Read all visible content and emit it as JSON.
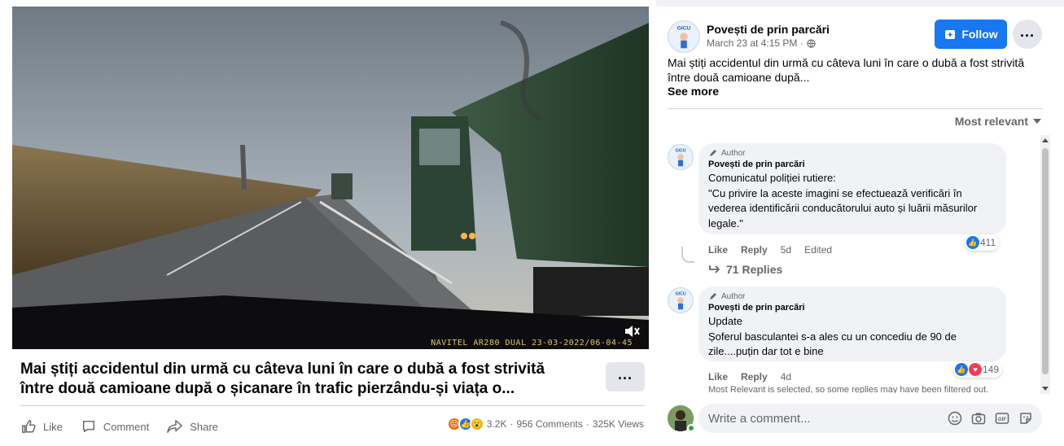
{
  "video": {
    "osd_text": "NAVITEL AR280 DUAL 23-03-2022/06-04-45"
  },
  "post_title": "Mai știți accidentul din urmă cu câteva luni în care o dubă a fost strivită între două camioane după o șicanare în trafic pierzându-și viața o...",
  "actions": {
    "like": "Like",
    "comment": "Comment",
    "share": "Share"
  },
  "stats": {
    "reactions": "3.2K",
    "comments": "956 Comments",
    "views": "325K Views",
    "separator": "·"
  },
  "post": {
    "page_name": "Povești de prin parcări",
    "time": "March 23 at 4:15 PM ·",
    "follow_label": "Follow",
    "text_line1": "Mai știți accidentul din urmă cu câteva luni în care o dubă a fost strivită",
    "text_line2": "între două camioane după...",
    "see_more": "See more"
  },
  "sort_label": "Most relevant",
  "comments": [
    {
      "tag": "Author",
      "name": "Povești de prin parcări",
      "lines": [
        "Comunicatul poliției rutiere:",
        "\"Cu privire la aceste imagini se efectuează verificări în",
        "vederea identificării conducătorului auto și luării măsurilor",
        "legale.\""
      ],
      "like": "Like",
      "reply": "Reply",
      "age": "5d",
      "edited": "Edited",
      "reaction_count": "411",
      "replies": "71 Replies"
    },
    {
      "tag": "Author",
      "name": "Povești de prin parcări",
      "lines": [
        "Update",
        "Șoferul basculantei s-a ales cu un concediu de 90 de",
        "zile....puțin dar tot e bine"
      ],
      "like": "Like",
      "reply": "Reply",
      "age": "4d",
      "reaction_count": "149"
    }
  ],
  "filter_note": "Most Relevant is selected, so some replies may have been filtered out.",
  "composer": {
    "placeholder": "Write a comment..."
  },
  "colors": {
    "accent": "#1877f2",
    "text_secondary": "#65676b",
    "bubble": "#f0f2f5"
  },
  "icons": [
    "volume-icon",
    "like-icon",
    "comment-icon",
    "share-icon",
    "globe-icon",
    "follow-page-icon",
    "more-icon",
    "pencil-icon",
    "reply-arrow-icon",
    "emoji-icon",
    "camera-icon",
    "gif-icon",
    "sticker-icon"
  ]
}
